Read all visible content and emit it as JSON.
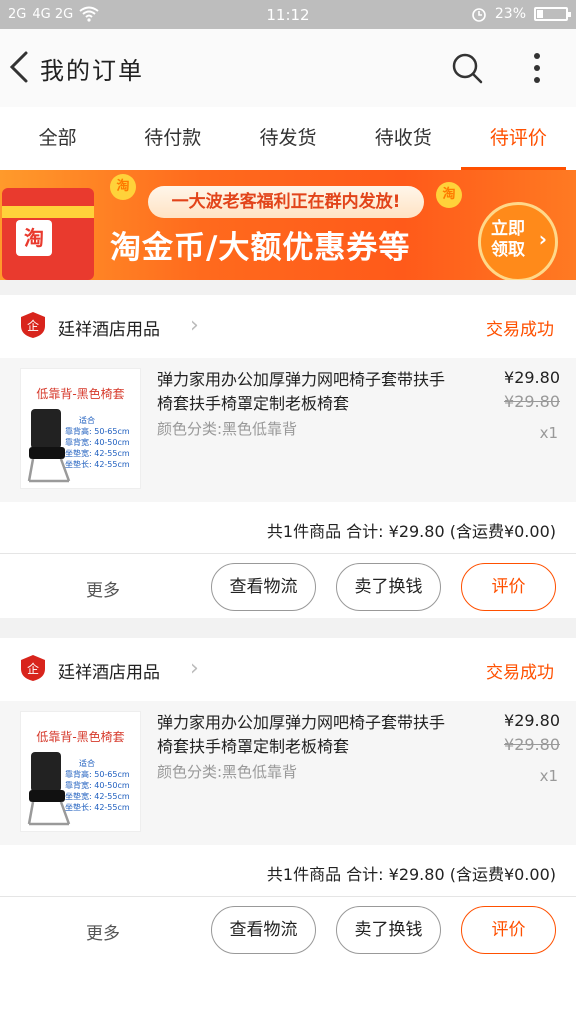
{
  "status_bar": {
    "signal1": "2G",
    "signal2": "4G 2G",
    "time": "11:12",
    "battery": "23%",
    "battery_level": 0.23
  },
  "header": {
    "title": "我的订单",
    "icons": [
      "back-arrow-icon",
      "search-icon",
      "more-vertical-icon"
    ]
  },
  "tabs": [
    {
      "label": "全部",
      "active": false
    },
    {
      "label": "待付款",
      "active": false
    },
    {
      "label": "待发货",
      "active": false
    },
    {
      "label": "待收货",
      "active": false
    },
    {
      "label": "待评价",
      "active": true
    }
  ],
  "banner": {
    "badge": "淘",
    "coin_label": "淘",
    "pill": "一大波老客福利正在群内发放!",
    "headline": "淘金币/大额优惠券等",
    "cta": "立即领取",
    "cta_line1": "立即",
    "cta_line2": "领取"
  },
  "orders": [
    {
      "shop_name": "廷祥酒店用品",
      "status": "交易成功",
      "product": {
        "thumb_title": "低靠背-黑色椅套",
        "thumb_fit": "适合",
        "thumb_specs": [
          "靠背高: 50-65cm",
          "靠背宽: 40-50cm",
          "坐垫宽: 42-55cm",
          "坐垫长: 42-55cm"
        ],
        "title": "弹力家用办公加厚弹力网吧椅子套带扶手椅套扶手椅罩定制老板椅套",
        "spec": "颜色分类:黑色低靠背",
        "price": "¥29.80",
        "original_price": "¥29.80",
        "quantity": "x1"
      },
      "summary": "共1件商品 合计: ¥29.80 (含运费¥0.00)",
      "more_label": "更多",
      "buttons": [
        "查看物流",
        "卖了换钱",
        "评价"
      ]
    },
    {
      "shop_name": "廷祥酒店用品",
      "status": "交易成功",
      "product": {
        "thumb_title": "低靠背-黑色椅套",
        "thumb_fit": "适合",
        "thumb_specs": [
          "靠背高: 50-65cm",
          "靠背宽: 40-50cm",
          "坐垫宽: 42-55cm",
          "坐垫长: 42-55cm"
        ],
        "title": "弹力家用办公加厚弹力网吧椅子套带扶手椅套扶手椅罩定制老板椅套",
        "spec": "颜色分类:黑色低靠背",
        "price": "¥29.80",
        "original_price": "¥29.80",
        "quantity": "x1"
      },
      "summary": "共1件商品 合计: ¥29.80 (含运费¥0.00)",
      "more_label": "更多",
      "buttons": [
        "查看物流",
        "卖了换钱",
        "评价"
      ]
    }
  ],
  "colors": {
    "accent": "#ff5000",
    "status_bar": "#bdbdbd",
    "muted_text": "#999999"
  }
}
